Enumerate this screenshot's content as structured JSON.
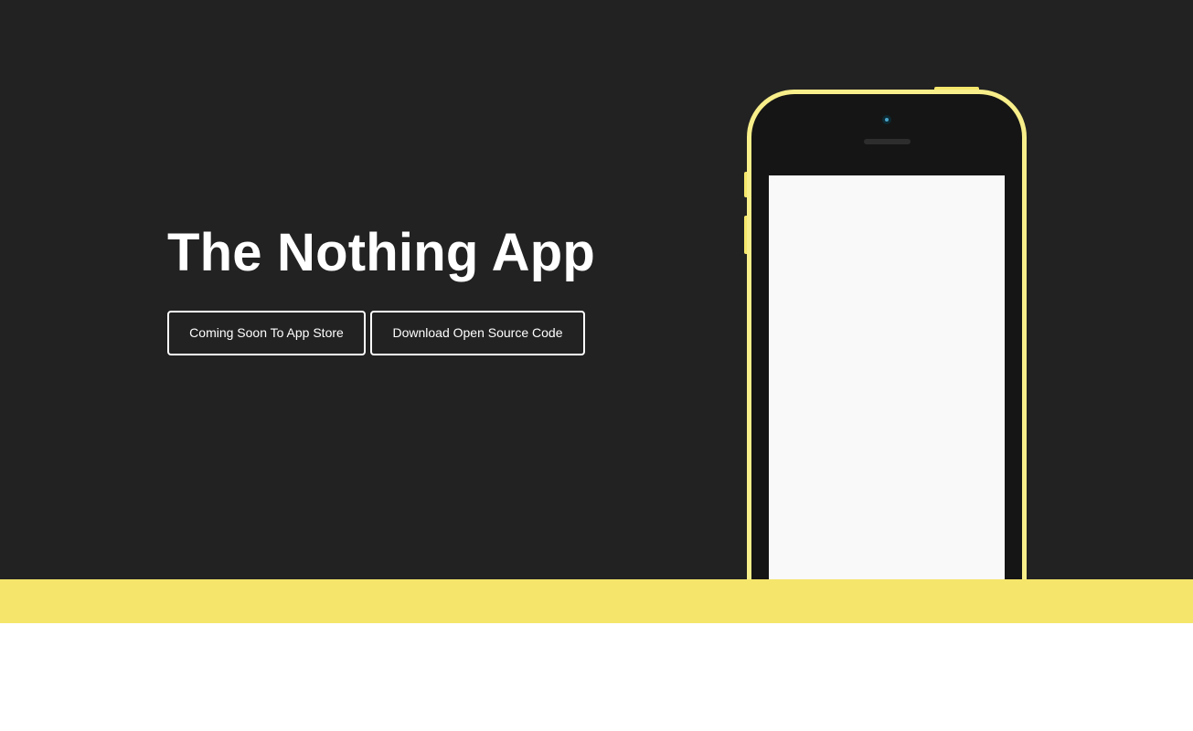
{
  "hero": {
    "title": "The Nothing App",
    "buttons": {
      "app_store_label": "Coming Soon To App Store",
      "download_label": "Download Open Source Code"
    },
    "background_color": "#222222"
  },
  "phone": {
    "frame_color": "#f8ee8a",
    "screen_color": "#f9f9f9"
  },
  "accent_band": {
    "color": "#f5e66b"
  }
}
